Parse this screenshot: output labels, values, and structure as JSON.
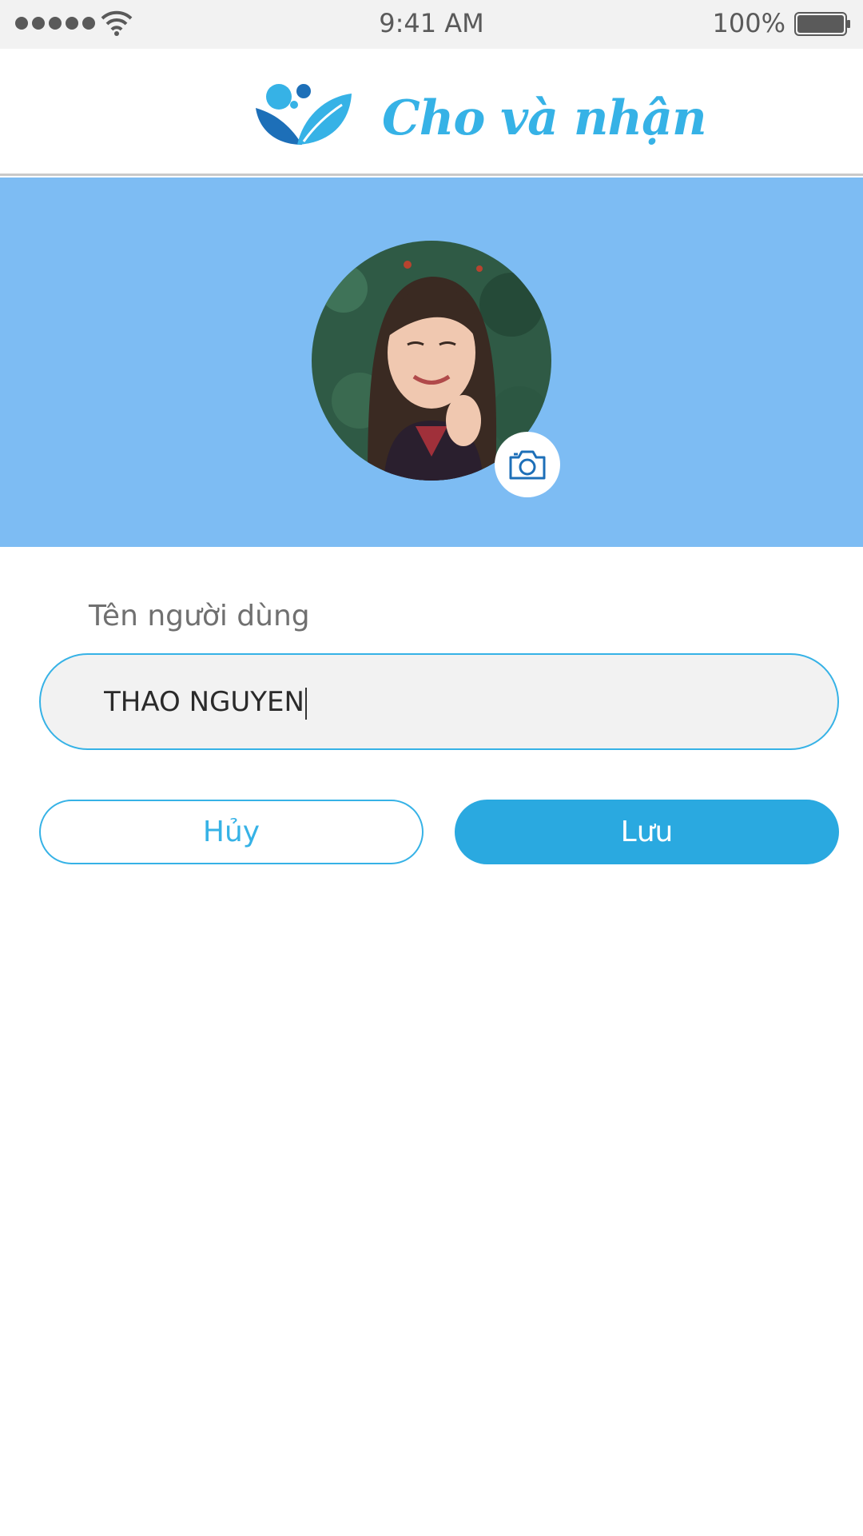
{
  "status_bar": {
    "time": "9:41 AM",
    "battery": "100%",
    "signal_icon": "signal-dots-icon",
    "wifi_icon": "wifi-icon",
    "battery_icon": "battery-icon"
  },
  "header": {
    "title": "Cho và nhận",
    "logo_icon": "leaf-logo-icon",
    "brand_color": "#36b2e6"
  },
  "profile": {
    "banner_color": "#7dbcf3",
    "avatar_icon": "profile-photo",
    "camera_icon": "camera-icon"
  },
  "form": {
    "username_label": "Tên người dùng",
    "username_value": "THAO NGUYEN"
  },
  "actions": {
    "cancel_label": "Hủy",
    "save_label": "Lưu",
    "primary_color": "#2aa9e0"
  }
}
